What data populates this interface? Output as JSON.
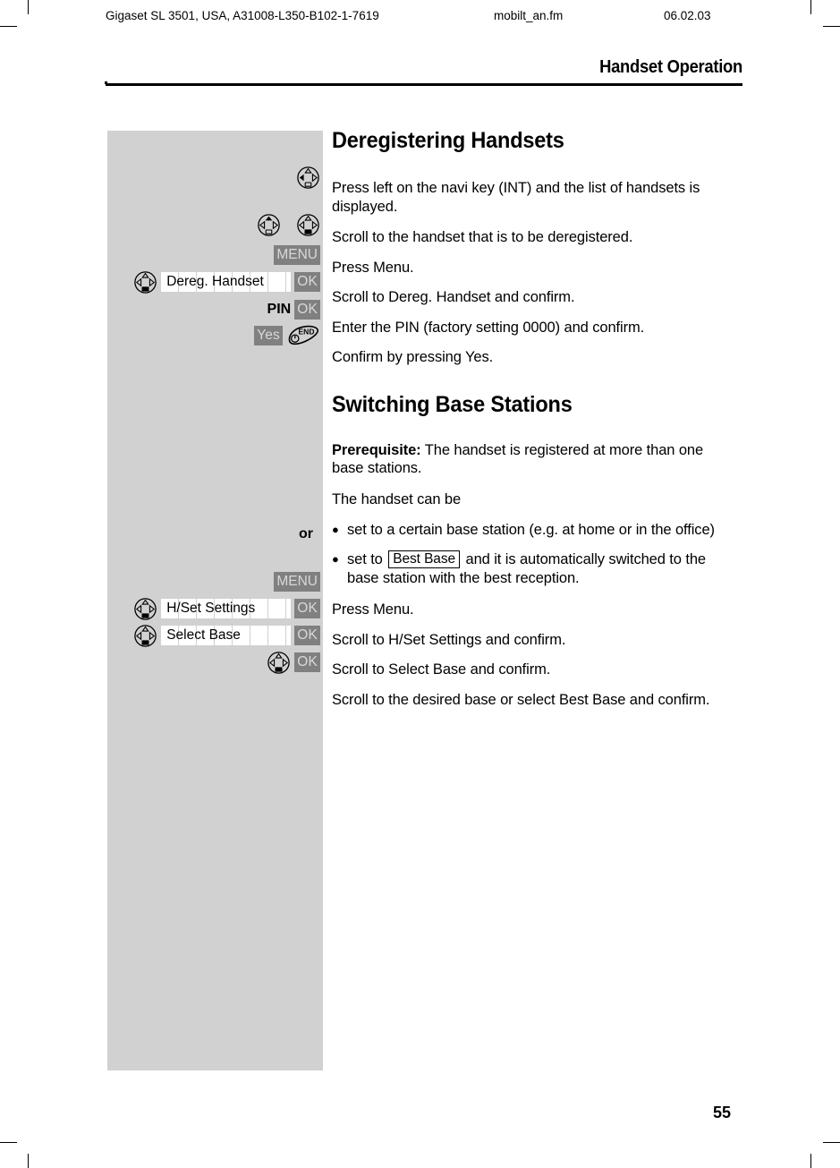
{
  "running_head": {
    "doc_id": "Gigaset SL 3501, USA, A31008-L350-B102-1-7619",
    "filename": "mobilt_an.fm",
    "date": "06.02.03"
  },
  "chapter": {
    "title": "Handset Operation"
  },
  "folio": {
    "page_number": "55"
  },
  "colors": {
    "panel_gray": "#d1d1d1",
    "softkey_bg": "#808080",
    "softkey_fg": "#d8d8d8",
    "display_bg": "#ffffff",
    "ink": "#000000"
  },
  "sections": [
    {
      "id": "deregistering-handsets",
      "heading": "Deregistering Handsets",
      "steps": [
        {
          "icons": [
            {
              "kind": "navi-left",
              "name": "navi-key-left-icon"
            }
          ],
          "text": "Press left on the navi key (INT) and the list of handsets is displayed."
        },
        {
          "icons": [
            {
              "kind": "navi-up",
              "name": "navi-key-up-icon"
            },
            {
              "kind": "navi-down",
              "name": "navi-key-down-icon"
            }
          ],
          "text": "Scroll to the handset that is to be deregistered."
        },
        {
          "softkeys": [
            {
              "label": "MENU",
              "name": "softkey-menu"
            }
          ],
          "text": "Press Menu."
        },
        {
          "icons": [
            {
              "kind": "navi-down",
              "name": "navi-key-down-icon"
            }
          ],
          "display_field": "Dereg. Handset",
          "softkeys": [
            {
              "label": "OK",
              "name": "softkey-ok"
            }
          ],
          "text": "Scroll to Dereg. Handset and confirm."
        },
        {
          "bold_label": "PIN",
          "softkeys": [
            {
              "label": "OK",
              "name": "softkey-ok"
            }
          ],
          "text": "Enter the PIN (factory setting 0000) and confirm."
        },
        {
          "softkeys": [
            {
              "label": "Yes",
              "name": "softkey-yes"
            }
          ],
          "end_key": {
            "label": "END",
            "name": "end-call-key-icon"
          },
          "text": "Confirm by pressing Yes."
        }
      ]
    },
    {
      "id": "switching-base-stations",
      "heading": "Switching Base Stations",
      "prerequisite_label": "Prerequisite:",
      "prerequisite_text": " The handset is registered at more than one base stations.",
      "intro": "The handset can be",
      "bullets": [
        {
          "before": "set to a certain base station (e.g. at home or in the office)",
          "boxed": null,
          "after": ""
        },
        {
          "before": "set to ",
          "boxed": "Best Base",
          "after": " and it is automatically switched to the base station with the best reception."
        }
      ],
      "or_label": "or",
      "steps": [
        {
          "softkeys": [
            {
              "label": "MENU",
              "name": "softkey-menu"
            }
          ],
          "text": "Press Menu."
        },
        {
          "icons": [
            {
              "kind": "navi-down",
              "name": "navi-key-down-icon"
            }
          ],
          "display_field": "H/Set Settings",
          "softkeys": [
            {
              "label": "OK",
              "name": "softkey-ok"
            }
          ],
          "text": "Scroll to H/Set Settings and confirm."
        },
        {
          "icons": [
            {
              "kind": "navi-down",
              "name": "navi-key-down-icon"
            }
          ],
          "display_field": "Select Base",
          "softkeys": [
            {
              "label": "OK",
              "name": "softkey-ok"
            }
          ],
          "text": "Scroll to Select Base and confirm."
        },
        {
          "icons": [
            {
              "kind": "navi-down",
              "name": "navi-key-down-icon"
            }
          ],
          "softkeys": [
            {
              "label": "OK",
              "name": "softkey-ok"
            }
          ],
          "text": "Scroll to the desired base or select Best Base and confirm."
        }
      ]
    }
  ]
}
